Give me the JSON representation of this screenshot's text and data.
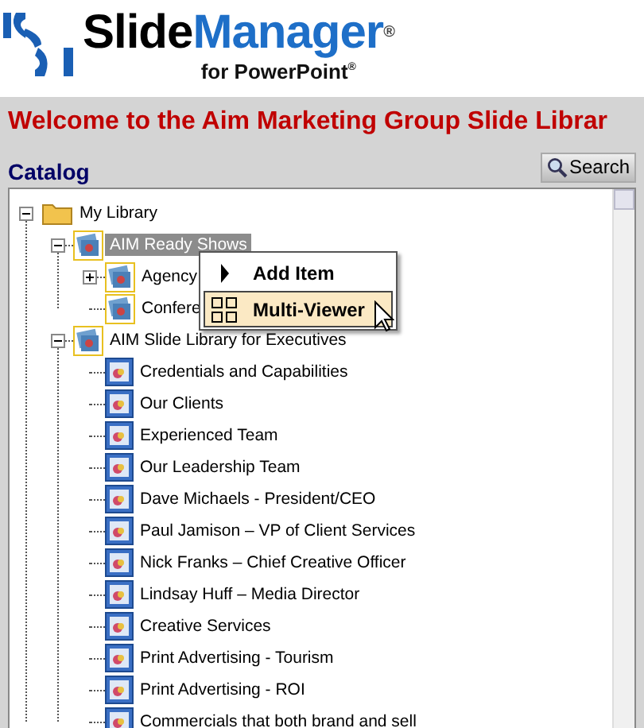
{
  "header": {
    "brand_first": "Slide",
    "brand_second": "Manager",
    "brand_mark": "®",
    "tagline": "for PowerPoint$^{®}$"
  },
  "welcome": "Welcome to the Aim Marketing Group Slide Librar",
  "catalog": {
    "title": "Catalog",
    "search_button": "Search"
  },
  "tree": [
    {
      "label": "My Library",
      "kind": "folder",
      "expanded": true,
      "selected": false,
      "children": [
        {
          "label": "AIM Ready Shows",
          "kind": "show",
          "expanded": true,
          "selected": true,
          "children": [
            {
              "label": "Agency",
              "kind": "show",
              "expanded": false,
              "selected": false
            },
            {
              "label": "Confere",
              "kind": "show",
              "selected": false
            }
          ]
        },
        {
          "label": "AIM Slide Library for Executives",
          "kind": "show",
          "expanded": true,
          "selected": false,
          "children": [
            {
              "label": "Credentials and Capabilities",
              "kind": "slide",
              "selected": false
            },
            {
              "label": "Our Clients",
              "kind": "slide",
              "selected": false
            },
            {
              "label": "Experienced Team",
              "kind": "slide",
              "selected": false
            },
            {
              "label": "Our Leadership Team",
              "kind": "slide",
              "selected": false
            },
            {
              "label": "Dave Michaels - President/CEO",
              "kind": "slide",
              "selected": false
            },
            {
              "label": "Paul Jamison – VP of Client Services",
              "kind": "slide",
              "selected": false
            },
            {
              "label": "Nick Franks – Chief Creative Officer",
              "kind": "slide",
              "selected": false
            },
            {
              "label": "Lindsay Huff – Media Director",
              "kind": "slide",
              "selected": false
            },
            {
              "label": "Creative Services",
              "kind": "slide",
              "selected": false
            },
            {
              "label": "Print Advertising - Tourism",
              "kind": "slide",
              "selected": false
            },
            {
              "label": "Print Advertising - ROI",
              "kind": "slide",
              "selected": false
            },
            {
              "label": "Commercials that both brand and sell",
              "kind": "slide",
              "selected": false
            }
          ]
        }
      ]
    }
  ],
  "context_menu": [
    {
      "label": "Add Item",
      "kind": "submenu",
      "selected": false
    },
    {
      "label": "Multi-Viewer",
      "kind": "grid",
      "selected": true
    }
  ]
}
